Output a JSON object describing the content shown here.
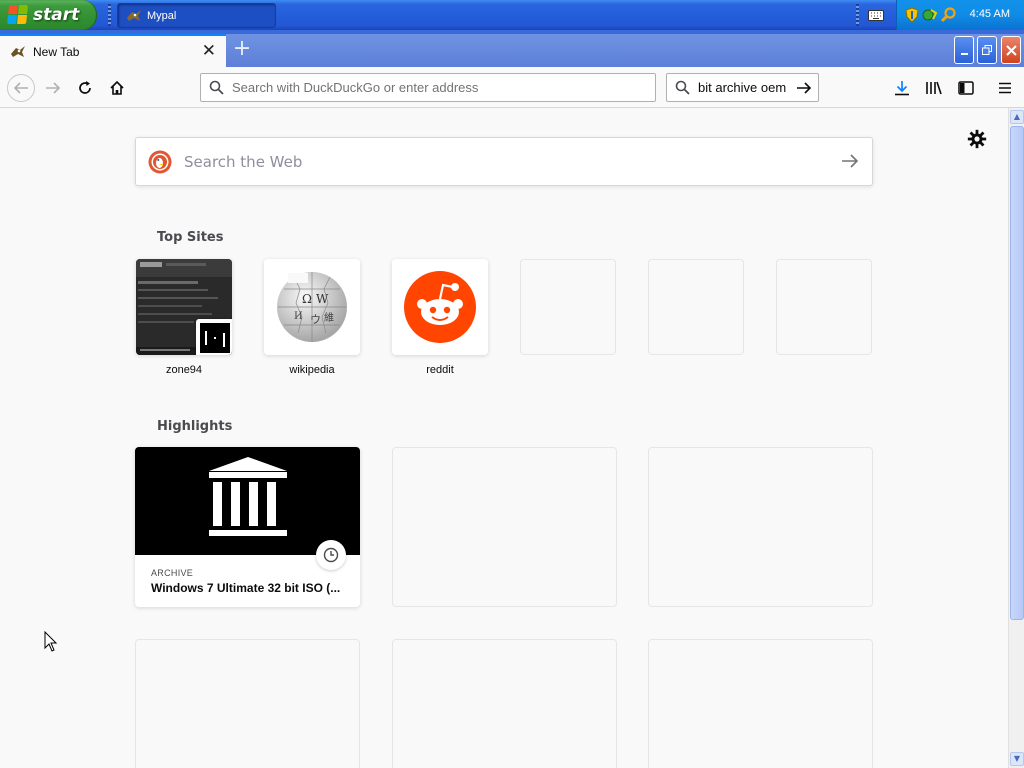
{
  "taskbar": {
    "start_label": "start",
    "task_button_label": "Mypal",
    "clock": "4:45 AM"
  },
  "tab": {
    "title": "New Tab"
  },
  "navbar": {
    "url_placeholder": "Search with DuckDuckGo or enter address",
    "search_value": "bit archive oem"
  },
  "newtab": {
    "web_search_placeholder": "Search the Web",
    "top_sites_title": "Top Sites",
    "top_sites": [
      {
        "label": "zone94"
      },
      {
        "label": "wikipedia"
      },
      {
        "label": "reddit"
      }
    ],
    "highlights_title": "Highlights",
    "highlight": {
      "site": "ARCHIVE",
      "title": "Windows 7 Ultimate 32 bit ISO (..."
    }
  },
  "colors": {
    "accent": "#0a84ff",
    "reddit": "#ff4500",
    "xp_taskbar": "#245edb",
    "xp_start": "#3d9a3d"
  }
}
